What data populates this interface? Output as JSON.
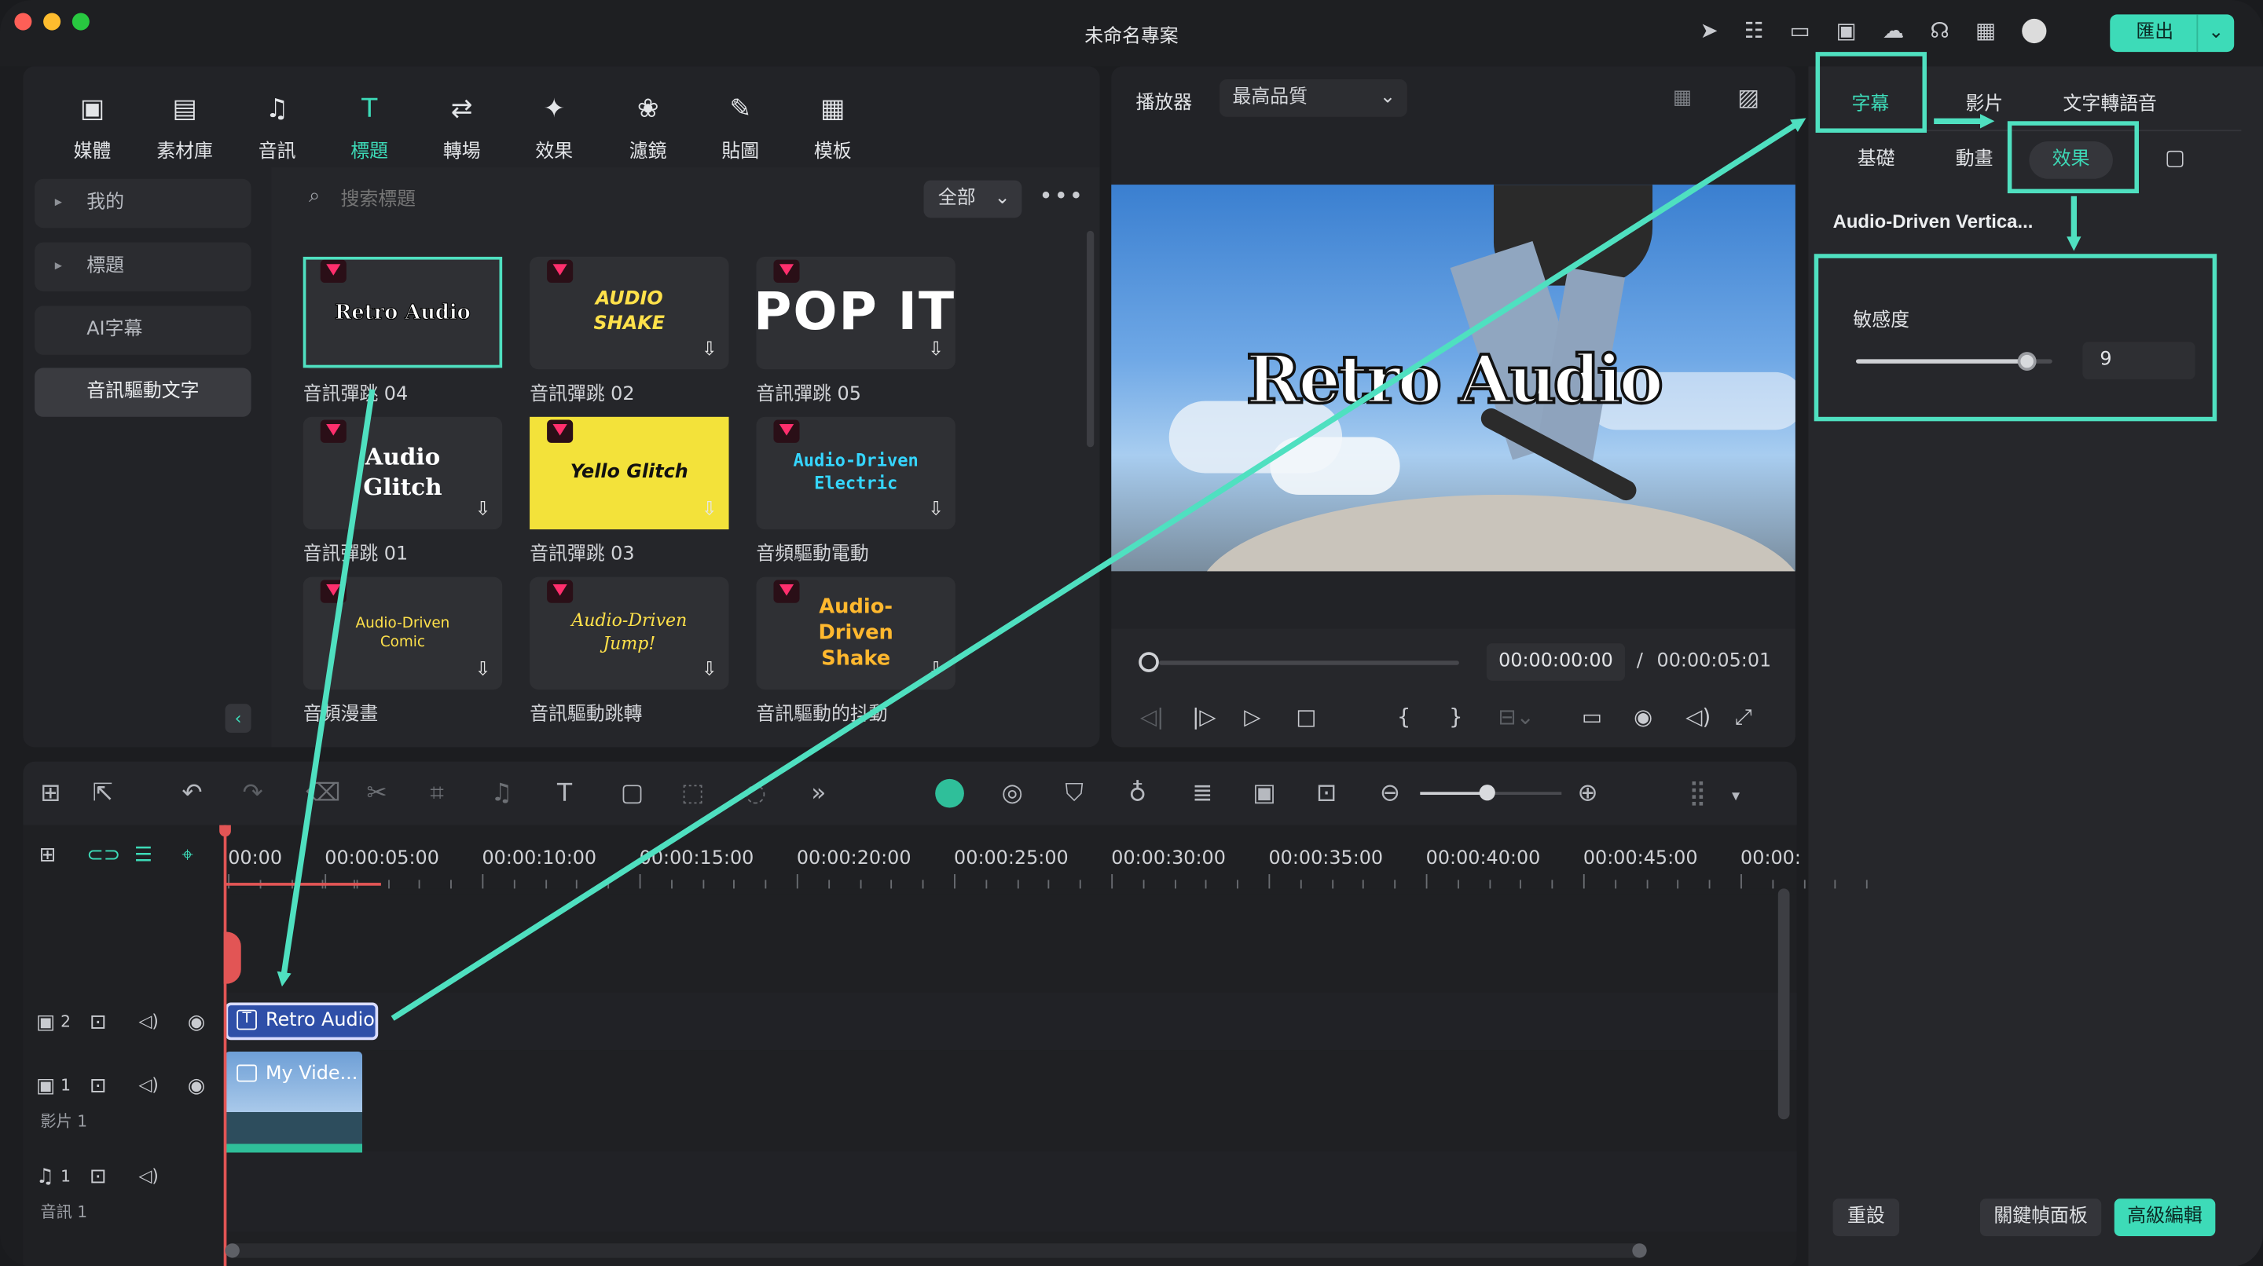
{
  "window": {
    "title": "未命名專案",
    "export_label": "匯出"
  },
  "top_tabs": [
    {
      "label": "媒體",
      "icon": "media-icon"
    },
    {
      "label": "素材庫",
      "icon": "stock-icon"
    },
    {
      "label": "音訊",
      "icon": "music-icon"
    },
    {
      "label": "標題",
      "icon": "title-icon",
      "active": true
    },
    {
      "label": "轉場",
      "icon": "transition-icon"
    },
    {
      "label": "效果",
      "icon": "effects-icon"
    },
    {
      "label": "濾鏡",
      "icon": "filter-icon"
    },
    {
      "label": "貼圖",
      "icon": "sticker-icon"
    },
    {
      "label": "模板",
      "icon": "template-icon"
    }
  ],
  "sidebar": {
    "items": [
      {
        "label": "我的",
        "arrow": "▸"
      },
      {
        "label": "標題",
        "arrow": "▸"
      },
      {
        "label": "AI字幕"
      },
      {
        "label": "音訊驅動文字",
        "active": true
      }
    ]
  },
  "search": {
    "placeholder": "搜索標題",
    "filter": "全部"
  },
  "cards": [
    {
      "title": "Retro Audio",
      "label": "音訊彈跳 04"
    },
    {
      "title": "AUDIO SHAKE",
      "label": "音訊彈跳 02"
    },
    {
      "title": "POP IT",
      "label": "音訊彈跳 05"
    },
    {
      "title": "Audio Glitch",
      "label": "音訊彈跳 01"
    },
    {
      "title": "Yello Glitch",
      "label": "音訊彈跳 03"
    },
    {
      "title": "Audio-Driven Electric",
      "label": "音頻驅動電動"
    },
    {
      "title": "Audio-Driven Comic",
      "label": "音頻漫畫"
    },
    {
      "title": "Audio-Driven Jump!",
      "label": "音訊驅動跳轉"
    },
    {
      "title": "Audio-Driven Shake",
      "label": "音訊驅動的抖動"
    }
  ],
  "player": {
    "label": "播放器",
    "quality": "最高品質",
    "overlay_text": "Retro Audio",
    "current_time": "00:00:00:00",
    "separator": "/",
    "total_time": "00:00:05:01"
  },
  "right_panel": {
    "tabs": [
      "字幕",
      "影片",
      "文字轉語音"
    ],
    "subtabs": [
      "基礎",
      "動畫",
      "效果"
    ],
    "effect_name": "Audio-Driven Vertica...",
    "sensitivity_label": "敏感度",
    "sensitivity_value": "9",
    "sensitivity_level": 0.9,
    "reset_label": "重設",
    "keyframe_label": "關鍵幀面板",
    "advanced_label": "高級編輯"
  },
  "timeline": {
    "ruler": [
      "00:00",
      "00:00:05:00",
      "00:00:10:00",
      "00:00:15:00",
      "00:00:20:00",
      "00:00:25:00",
      "00:00:30:00",
      "00:00:35:00",
      "00:00:40:00",
      "00:00:45:00",
      "00:00:"
    ],
    "tracks": [
      {
        "num": "2",
        "name": ""
      },
      {
        "num": "1",
        "name": "影片 1"
      },
      {
        "num": "1",
        "name": "音訊 1"
      }
    ],
    "title_clip": "Retro Audio",
    "video_clip": "My Vide..."
  },
  "colors": {
    "accent": "#4fe0c0",
    "button_green": "#3ddbb8"
  }
}
